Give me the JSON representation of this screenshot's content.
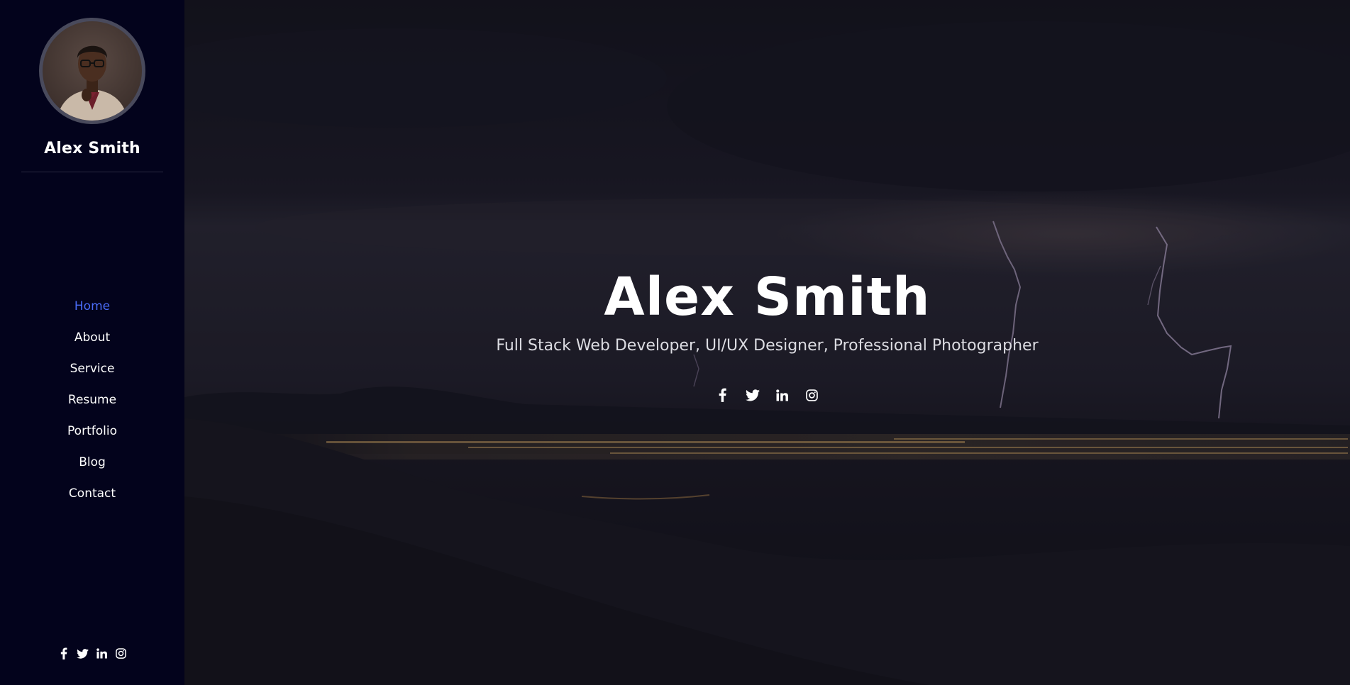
{
  "sidebar": {
    "profile_name": "Alex Smith",
    "nav": [
      {
        "label": "Home",
        "active": true
      },
      {
        "label": "About"
      },
      {
        "label": "Service"
      },
      {
        "label": "Resume"
      },
      {
        "label": "Portfolio"
      },
      {
        "label": "Blog"
      },
      {
        "label": "Contact"
      }
    ],
    "social_icons": [
      "facebook-icon",
      "twitter-icon",
      "linkedin-icon",
      "instagram-icon"
    ]
  },
  "hero": {
    "title": "Alex Smith",
    "subtitle": "Full Stack Web Developer, UI/UX Designer, Professional Photographer",
    "social_icons": [
      "facebook-icon",
      "twitter-icon",
      "linkedin-icon",
      "instagram-icon"
    ]
  },
  "colors": {
    "sidebar_bg": "#03031c",
    "accent": "#4a6cf7",
    "text": "#ffffff"
  }
}
